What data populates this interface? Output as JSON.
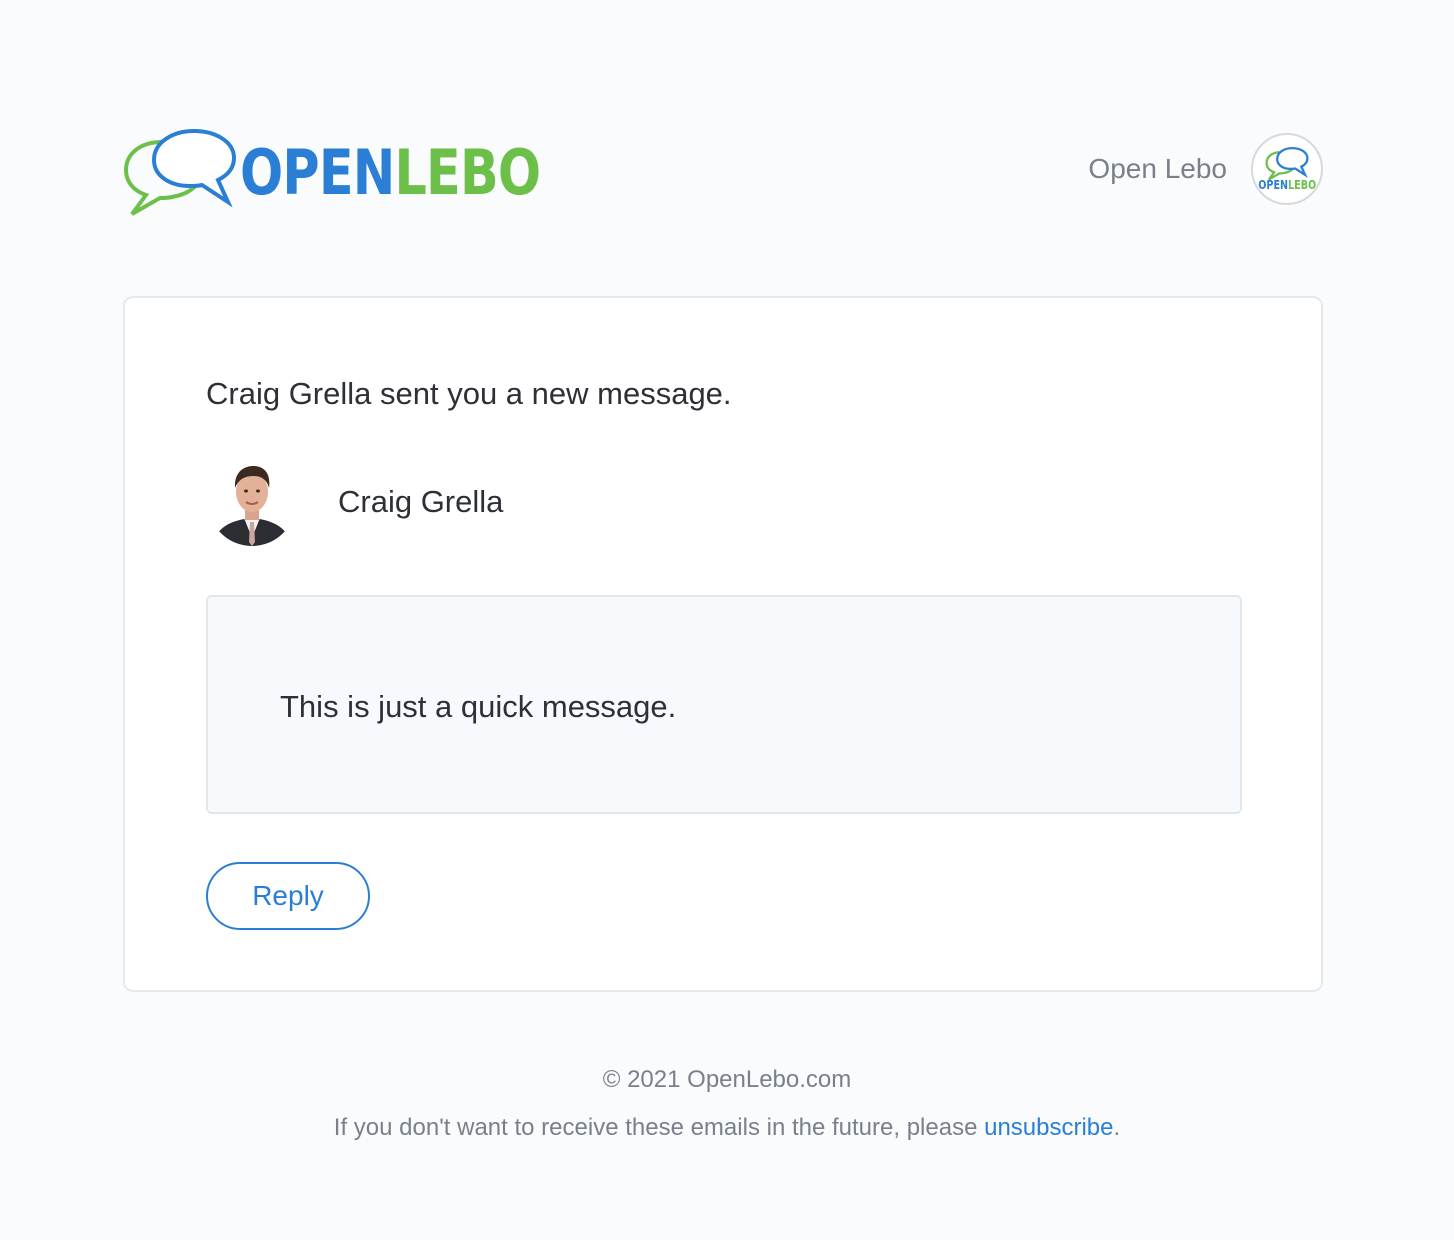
{
  "header": {
    "logo": {
      "text_open": "OPEN",
      "text_lebo": "LEBO",
      "colors": {
        "blue": "#2a7fd4",
        "green": "#6cc04a"
      },
      "icon": "chat-bubbles-icon"
    },
    "account_name": "Open Lebo",
    "account_avatar": {
      "text_open": "OPEN",
      "text_lebo": "LEBO"
    }
  },
  "card": {
    "headline": "Craig Grella sent you a new message.",
    "sender": {
      "name": "Craig Grella",
      "avatar": "person-portrait"
    },
    "message": "This is just a quick message.",
    "reply_label": "Reply"
  },
  "footer": {
    "copyright": "© 2021 OpenLebo.com",
    "unsubscribe_prefix": "If you don't want to receive these emails in the future, please ",
    "unsubscribe_link": "unsubscribe",
    "unsubscribe_suffix": "."
  },
  "colors": {
    "accent": "#2a7fd4",
    "brand_green": "#6cc04a",
    "text_dark": "#2d3036",
    "text_muted": "#7a808a",
    "page_bg": "#f9fbfd"
  }
}
